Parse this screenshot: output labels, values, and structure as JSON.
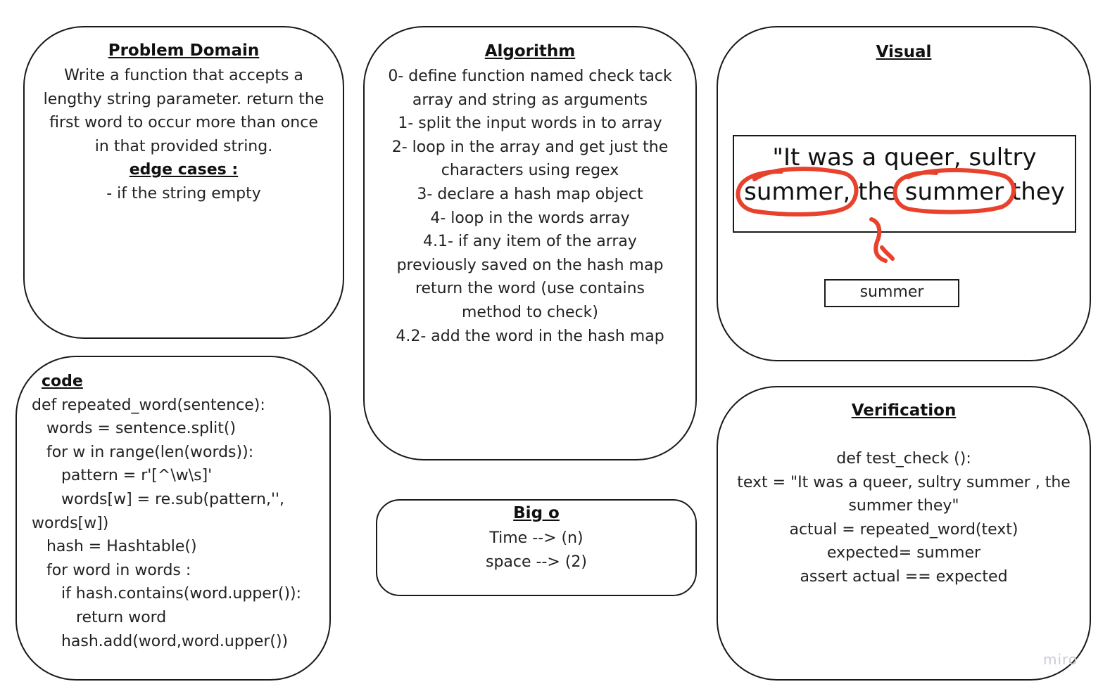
{
  "problem_domain": {
    "title": "Problem Domain",
    "lines": [
      "Write a function that accepts a",
      "lengthy string parameter. return the",
      "first word to occur more than once",
      "in that provided string."
    ],
    "edge_title": "edge cases :",
    "edge_lines": [
      "- if the string empty"
    ]
  },
  "algorithm": {
    "title": "Algorithm",
    "lines": [
      "0- define function named check tack",
      "array and string as arguments",
      "1- split the input words in to array",
      "2- loop in the array and get just the",
      "characters using regex",
      "3- declare a hash map object",
      "4- loop in the words array",
      "4.1- if any item of the array",
      "previously saved on the hash map",
      "return the word (use contains",
      "method to check)",
      "4.2- add the word in the hash map"
    ]
  },
  "visual": {
    "title": "Visual",
    "sentence_lines": [
      "\"It was a queer, sultry",
      "summer, the summer they"
    ],
    "answer": "summer",
    "annotation_color": "#e8412c"
  },
  "code": {
    "title": "code",
    "lines": [
      "def repeated_word(sentence):",
      "   words = sentence.split()",
      "   for w in range(len(words)):",
      "      pattern = r'[^\\w\\s]'",
      "      words[w] = re.sub(pattern,'',",
      "words[w])",
      "   hash = Hashtable()",
      "   for word in words :",
      "      if hash.contains(word.upper()):",
      "         return word",
      "      hash.add(word,word.upper())"
    ]
  },
  "big_o": {
    "title": "Big o",
    "lines": [
      "Time --> (n)",
      "space --> (2)"
    ]
  },
  "verification": {
    "title": "Verification",
    "lines": [
      "def test_check ():",
      "text = \"It was a queer, sultry summer , the",
      "summer they\"",
      "actual = repeated_word(text)",
      "expected= summer",
      "assert actual == expected"
    ]
  },
  "watermark": "miro"
}
